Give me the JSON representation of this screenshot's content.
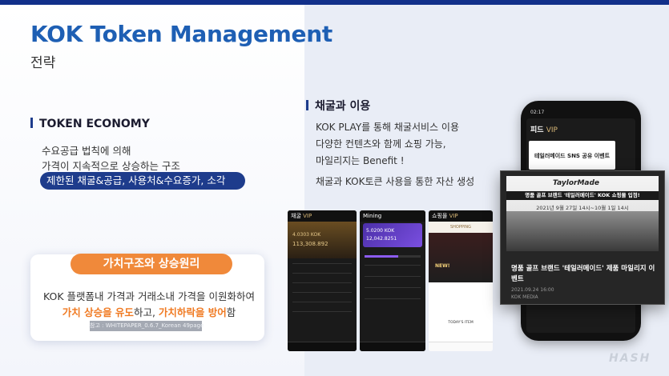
{
  "slide": {
    "title": "KOK Token Management",
    "subtitle": "전략",
    "colors": {
      "accent": "#1e5fb4",
      "navy": "#1e3c8c",
      "orange": "#f0893a"
    }
  },
  "token_economy": {
    "heading": "TOKEN ECONOMY",
    "bullet1": "수요공급 법칙에 의해",
    "bullet2": "가격이 지속적으로 상승하는 구조",
    "highlight": "제한된 채굴&공급, 사용처&수요증가, 소각"
  },
  "value_card": {
    "pill": "가치구조와 상승원리",
    "line1": "KOK 플랫폼내 가격과 거래소내 가격을 이원화하여",
    "line2_a": "가치 상승을 유도",
    "line2_b": "하고, ",
    "line2_c": "가치하락을 방어",
    "line2_d": "함",
    "ref": "참고 : WHITEPAPER_0.6.7_Korean 49page"
  },
  "mining": {
    "heading": "채굴과 이용",
    "line1": "KOK PLAY를 통해 채굴서비스 이용",
    "line2": "다양한 컨텐츠와 함께 쇼핑 가능,",
    "line3": "마일리지는 Benefit !",
    "line4": "채굴과 KOK토큰 사용을 통한 자산 생성"
  },
  "phones": {
    "p1": {
      "title": "채굴",
      "vip": "VIP",
      "bal1": "4.0303 KOK",
      "bal2": "113,308.892"
    },
    "p2": {
      "title": "Mining",
      "bal1": "5.0200 KOK",
      "bal2": "12,042.8251"
    },
    "p3": {
      "title": "쇼핑몰",
      "vip": "VIP",
      "shop": "SHOPPING",
      "new": "NEW!",
      "today": "TODAY'S ITEM"
    }
  },
  "big_phone": {
    "time": "02:17",
    "feed": "피드",
    "vip": "VIP",
    "banner_title": "테일러메이드 SNS 공유 이벤트",
    "logo": "TaylorMade",
    "popup_title": "명품 골프 브랜드 '테일러메이드' KOK 쇼핑몰 입점!",
    "popup_date": "2021년 9월 27일 14시~10월 1일 14시",
    "headline": "명품 골프 브랜드 '테일러메이드' 제품 마일리지 이벤트",
    "meta_date": "2021.09.24 16:00",
    "meta_src": "KOK MEDIA"
  },
  "brand": {
    "hash": "HASH"
  }
}
